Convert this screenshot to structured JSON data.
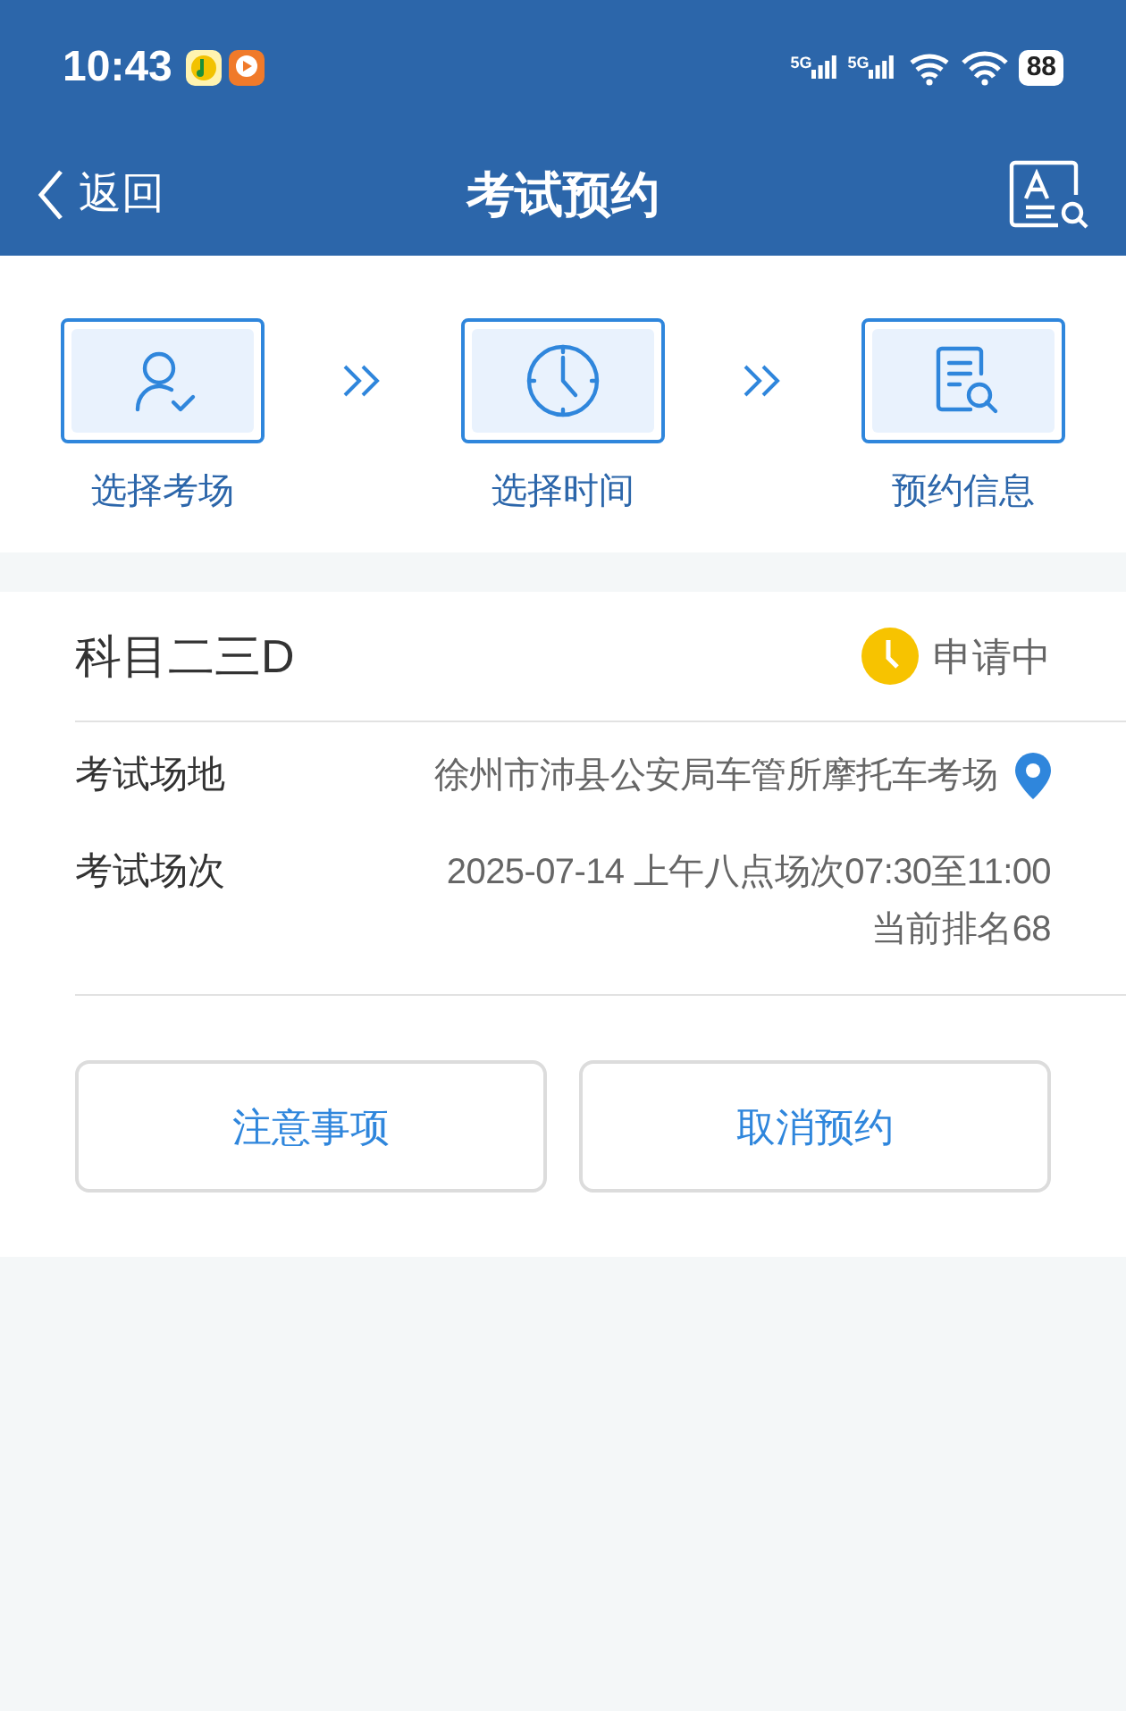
{
  "status_bar": {
    "time": "10:43",
    "signal_labels": [
      "5G",
      "5G"
    ],
    "battery": "88"
  },
  "nav": {
    "back": "返回",
    "title": "考试预约"
  },
  "steps": [
    {
      "kind": "person",
      "label": "选择考场"
    },
    {
      "kind": "clock",
      "label": "选择时间"
    },
    {
      "kind": "document",
      "label": "预约信息"
    }
  ],
  "card": {
    "subject": "科目二三D",
    "status": "申请中",
    "fields": [
      {
        "label": "考试场地",
        "lines": [
          "徐州市沛县公安局车管所摩托车考场"
        ],
        "kind": "location"
      },
      {
        "label": "考试场次",
        "lines": [
          "2025-07-14 上午八点场次07:30至11:00",
          "当前排名68"
        ],
        "kind": "plain"
      }
    ],
    "buttons": [
      "注意事项",
      "取消预约"
    ]
  }
}
